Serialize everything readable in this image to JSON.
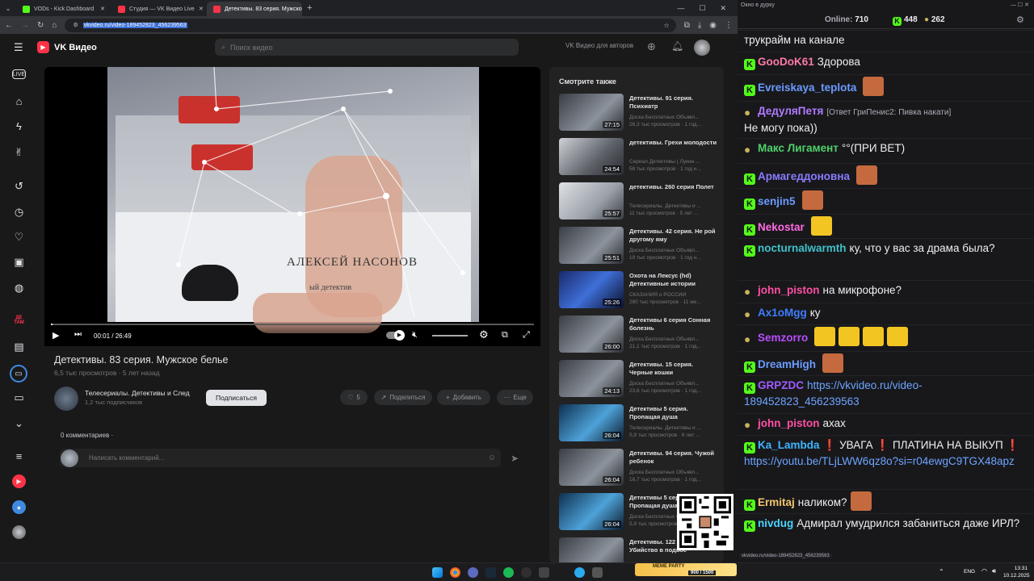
{
  "browser": {
    "tabs": [
      {
        "title": "VODs - Kick Dashboard",
        "color": "#53fc18"
      },
      {
        "title": "Студия — VK Видео Live",
        "color": "#ff3347"
      },
      {
        "title": "Детективы. 83 серия. Мужско",
        "color": "#ff3347"
      }
    ],
    "url": "vkvideo.ru/video-189452823_456239563"
  },
  "vk": {
    "logo": "VK Видео",
    "search_placeholder": "Поиск видео",
    "authors_link": "VK Видео для авторов",
    "nav_icons": [
      "live-icon",
      "home-icon",
      "lightning-icon",
      "shorts-icon",
      "history-icon",
      "clock-icon",
      "heart-icon",
      "subscriptions-icon",
      "channels-icon",
      "detam-icon",
      "catalog-icon",
      "tv-icon",
      "screen-icon",
      "chevron-down-icon",
      "playlist-icon",
      "vk-live-icon",
      "profile-icon",
      "avatar-icon"
    ],
    "nav_label_detam": "ДЕ ТАМ"
  },
  "player": {
    "time": "00:01 / 26:49",
    "progress": 0.001,
    "name_card": "АЛЕКСЕЙ НАСОНОВ",
    "name_card_sub": "ый детектив"
  },
  "video": {
    "title": "Детективы. 83 серия. Мужское белье",
    "views": "6,5 тыс просмотров",
    "age": "5 лет назад",
    "channel": "Телесериалы. Детективы и След",
    "subscribers": "1,2 тыс подписчиков",
    "subscribe": "Подписаться",
    "likes": "5",
    "share": "Поделиться",
    "add": "Добавить",
    "more": "Еще",
    "comments_count": "0 комментариев",
    "comment_placeholder": "Написать комментарий..."
  },
  "recommendations": {
    "title": "Смотрите также",
    "items": [
      {
        "title": "Детективы. 91 серия. Психиатр",
        "channel": "Доска Бесплатных Объявл...",
        "meta": "26,3 тыс просмотров · 1 год...",
        "duration": "27:15"
      },
      {
        "title": "детективы. Грехи молодости",
        "channel": "Сериал Детективы ( Лукин ...",
        "meta": "58 тыс просмотров · 1 год н...",
        "duration": "24:54"
      },
      {
        "title": "детективы. 260 серия Полет",
        "channel": "Телесериалы. Детективы и ...",
        "meta": "11 тыс просмотров · 5 лет ...",
        "duration": "25:57"
      },
      {
        "title": "Детективы. 42 серия. Не рой другому яму",
        "channel": "Доска Бесплатных Объявл...",
        "meta": "19 тыс просмотров · 1 год н...",
        "duration": "25:51"
      },
      {
        "title": "Охота на Лексус (hd) Детективные истории",
        "channel": "СКАЗАНИЯ о РОССИИ",
        "meta": "280 тыс просмотров · 11 мe...",
        "duration": "25:26"
      },
      {
        "title": "Детективы 6 серия Сонная болезнь",
        "channel": "Доска Бесплатных Объявл...",
        "meta": "21,1 тыс просмотров · 1 год...",
        "duration": "26:00"
      },
      {
        "title": "Детективы. 15 серия. Черные кошки",
        "channel": "Доска Бесплатных Объявл...",
        "meta": "23,6 тыс просмотров · 1 год...",
        "duration": "24:13"
      },
      {
        "title": "Детективы 5 серия. Пропащая душа",
        "channel": "Телесериалы. Детективы и ...",
        "meta": "5,9 тыс просмотров · 6 лет ...",
        "duration": "26:04"
      },
      {
        "title": "Детективы. 94 серия. Чужой ребенок",
        "channel": "Доска Бесплатных Объявл...",
        "meta": "16,7 тыс просмотров · 1 год...",
        "duration": "26:04"
      },
      {
        "title": "Детективы 5 серия. Пропащая душа",
        "channel": "Доска Бесплатных Объявл...",
        "meta": "5,9 тыс просмотров · 1 год...",
        "duration": "26:04"
      },
      {
        "title": "Детективы. 122 серия. Убийство в подвоe",
        "channel": "",
        "meta": "",
        "duration": ""
      }
    ]
  },
  "statusbar_url": "vkvideo.ru/video-189452823_456239563",
  "meme_party": {
    "label": "MEME PARTY",
    "counter": "900 / 1500"
  },
  "chat": {
    "window_title": "Окно в дурку",
    "online_label": "Online:",
    "online": "710",
    "kick_count": "448",
    "viewers2": "262",
    "messages": [
      {
        "user": "",
        "color": "#efeff1",
        "text": "трукрайм на канале"
      },
      {
        "user": "GooDoK61",
        "color": "#ff7aa8",
        "text": "Здорова"
      },
      {
        "user": "Evreiskaya_teplota",
        "color": "#6b9bff",
        "text": ""
      },
      {
        "user": "ДедуляПетя",
        "color": "#b07bff",
        "reply": "[Ответ ГриПенис2: Пивка накати]",
        "text": "Не могу пока))"
      },
      {
        "user": "Макс Лигамент",
        "color": "#4fd16a",
        "text": "°°(ПРИ ВЕТ)"
      },
      {
        "user": "Армагеддоновна",
        "color": "#8a7bff",
        "text": ""
      },
      {
        "user": "senjin5",
        "color": "#6b9bff",
        "text": ""
      },
      {
        "user": "Nekostar",
        "color": "#ff6be0",
        "text": ""
      },
      {
        "user": "nocturnalwarmth",
        "color": "#3fc1c9",
        "text": "ку, что у вас за драма была?"
      },
      {
        "user": "john_piston",
        "color": "#ff4fa3",
        "text": "на микрофоне?"
      },
      {
        "user": "Ax1oMgg",
        "color": "#3f7dff",
        "text": "ку"
      },
      {
        "user": "Semzorro",
        "color": "#b84dff",
        "text": ""
      },
      {
        "user": "DreamHigh",
        "color": "#6b9bff",
        "text": ""
      },
      {
        "user": "GRPZDC",
        "color": "#a05cff",
        "text": "https://vkvideo.ru/video-189452823_456239563"
      },
      {
        "user": "john_piston",
        "color": "#ff4fa3",
        "text": "ахах"
      },
      {
        "user": "Ka_Lambda",
        "color": "#3fb5ff",
        "text": "❗ УВАГА ❗ ПЛАТИНА НА ВЫКУП ❗",
        "link": "https://youtu.be/TLjLWW6qz8o?si=r04ewgC9TGX48apz"
      },
      {
        "user": "Ermitaj",
        "color": "#f2c66d",
        "text": "наликом?"
      },
      {
        "user": "nivdug",
        "color": "#4bd3ff",
        "text": "Адмирал умудрился забаниться даже ИРЛ?"
      }
    ]
  },
  "taskbar": {
    "lang": "ENG",
    "time": "13:31",
    "date": "10.12.2025"
  }
}
